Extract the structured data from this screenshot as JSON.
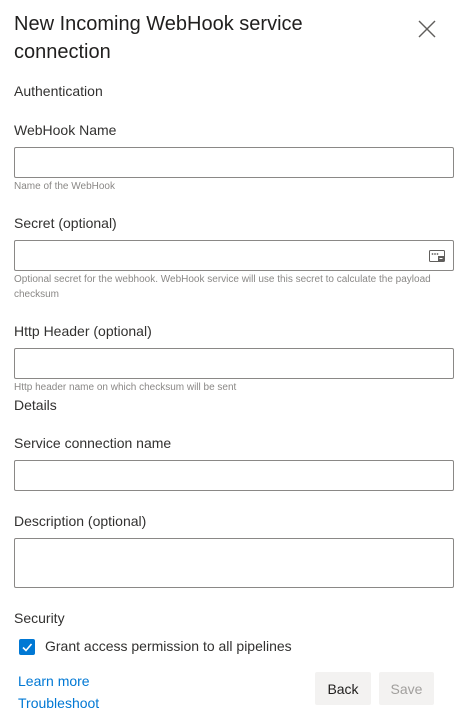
{
  "header": {
    "title": "New Incoming WebHook service connection",
    "close_icon": "close-icon"
  },
  "sections": {
    "authentication": "Authentication",
    "details": "Details",
    "security": "Security"
  },
  "fields": {
    "webhook_name": {
      "label": "WebHook Name",
      "value": "",
      "helper": "Name of the WebHook"
    },
    "secret": {
      "label": "Secret (optional)",
      "value": "",
      "helper": "Optional secret for the webhook. WebHook service will use this secret to calculate the payload checksum",
      "toggle_icon": "password-reveal-icon"
    },
    "http_header": {
      "label": "Http Header (optional)",
      "value": "",
      "helper": "Http header name on which checksum will be sent"
    },
    "service_connection_name": {
      "label": "Service connection name",
      "value": ""
    },
    "description": {
      "label": "Description (optional)",
      "value": ""
    }
  },
  "security": {
    "grant_access_label": "Grant access permission to all pipelines",
    "grant_access_checked": true
  },
  "footer": {
    "learn_more": "Learn more",
    "troubleshoot": "Troubleshoot",
    "back_label": "Back",
    "save_label": "Save",
    "save_disabled": true
  },
  "colors": {
    "accent": "#0078d4",
    "border": "#8a8886",
    "helper_text": "#8a8886",
    "button_bg": "#f3f2f1",
    "disabled_text": "#a19f9d"
  }
}
